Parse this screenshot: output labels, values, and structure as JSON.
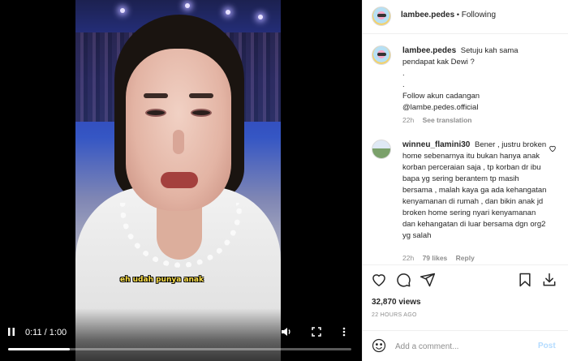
{
  "video": {
    "caption": "eh udah punya anak",
    "time_current": "0:11",
    "time_separator": " / ",
    "time_total": "1:00",
    "progress_fraction": 0.18
  },
  "post": {
    "author": "lambee.pedes",
    "separator": "•",
    "follow_status": "Following"
  },
  "caption": {
    "author": "lambee.pedes",
    "line1": "Setuju kah sama",
    "line2": "pendapat kak Dewi ?",
    "line3": ".",
    "line4": ".",
    "line5": "Follow akun cadangan",
    "line6": "@lambe.pedes.official",
    "time": "22h",
    "see_translation": "See translation"
  },
  "comments": [
    {
      "author": "winneu_flamini30",
      "text": "Bener , justru broken home sebenarnya itu bukan hanya anak korban perceraian saja , tp korban dr ibu bapa yg sering berantem tp masih bersama , malah kaya ga ada kehangatan kenyamanan di rumah , dan bikin anak jd broken home sering nyari kenyamanan dan kehangatan di luar bersama dgn org2 yg salah",
      "time": "22h",
      "likes": "79 likes",
      "reply": "Reply"
    }
  ],
  "stats": {
    "views": "32,870 views",
    "ago": "22 HOURS AGO"
  },
  "comment_box": {
    "placeholder": "Add a comment...",
    "post_label": "Post"
  },
  "icons": {
    "play_pause": "pause-icon",
    "volume": "volume-icon",
    "fullscreen": "fullscreen-icon",
    "more": "more-vertical-icon",
    "like": "heart-icon",
    "comment": "comment-icon",
    "share": "share-icon",
    "save": "bookmark-icon",
    "emoji": "emoji-icon"
  },
  "colors": {
    "post_button_disabled": "#b3dbff",
    "secondary_text": "#8e8e8e"
  }
}
